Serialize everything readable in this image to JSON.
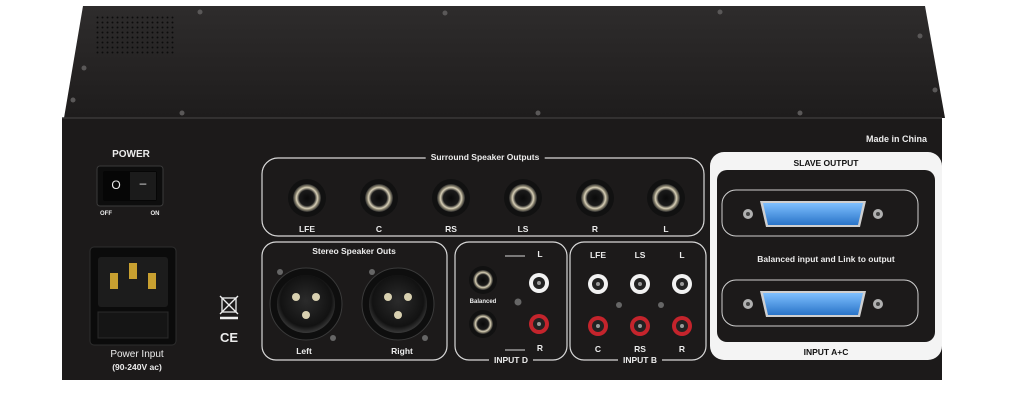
{
  "power": {
    "title": "POWER",
    "switch_off_mark": "O",
    "switch_on_mark": "–",
    "off_label": "OFF",
    "on_label": "ON"
  },
  "power_input": {
    "label": "Power Input",
    "voltage": "(90-240V ac)"
  },
  "made_in": "Made in China",
  "ce_mark": "CE",
  "surround_outputs": {
    "title": "Surround Speaker  Outputs",
    "channels": [
      "LFE",
      "C",
      "RS",
      "LS",
      "R",
      "L"
    ]
  },
  "stereo_outs": {
    "title": "Stereo Speaker Outs",
    "left": "Left",
    "right": "Right"
  },
  "input_d": {
    "title": "INPUT D",
    "balanced": "Balanced",
    "top": "L",
    "bottom": "R"
  },
  "input_b": {
    "title": "INPUT B",
    "top_labels": [
      "LFE",
      "LS",
      "L"
    ],
    "bottom_labels": [
      "C",
      "RS",
      "R"
    ]
  },
  "slave": {
    "title": "SLAVE OUTPUT",
    "middle": "Balanced input and Link to output",
    "bottom_title": "INPUT A+C"
  },
  "colors": {
    "chassis": "#1c1a1a",
    "top_cover": "#2a2828",
    "rca_red": "#c4242c",
    "rca_white": "#f2f2f2",
    "db25": "#3d8fe0"
  }
}
